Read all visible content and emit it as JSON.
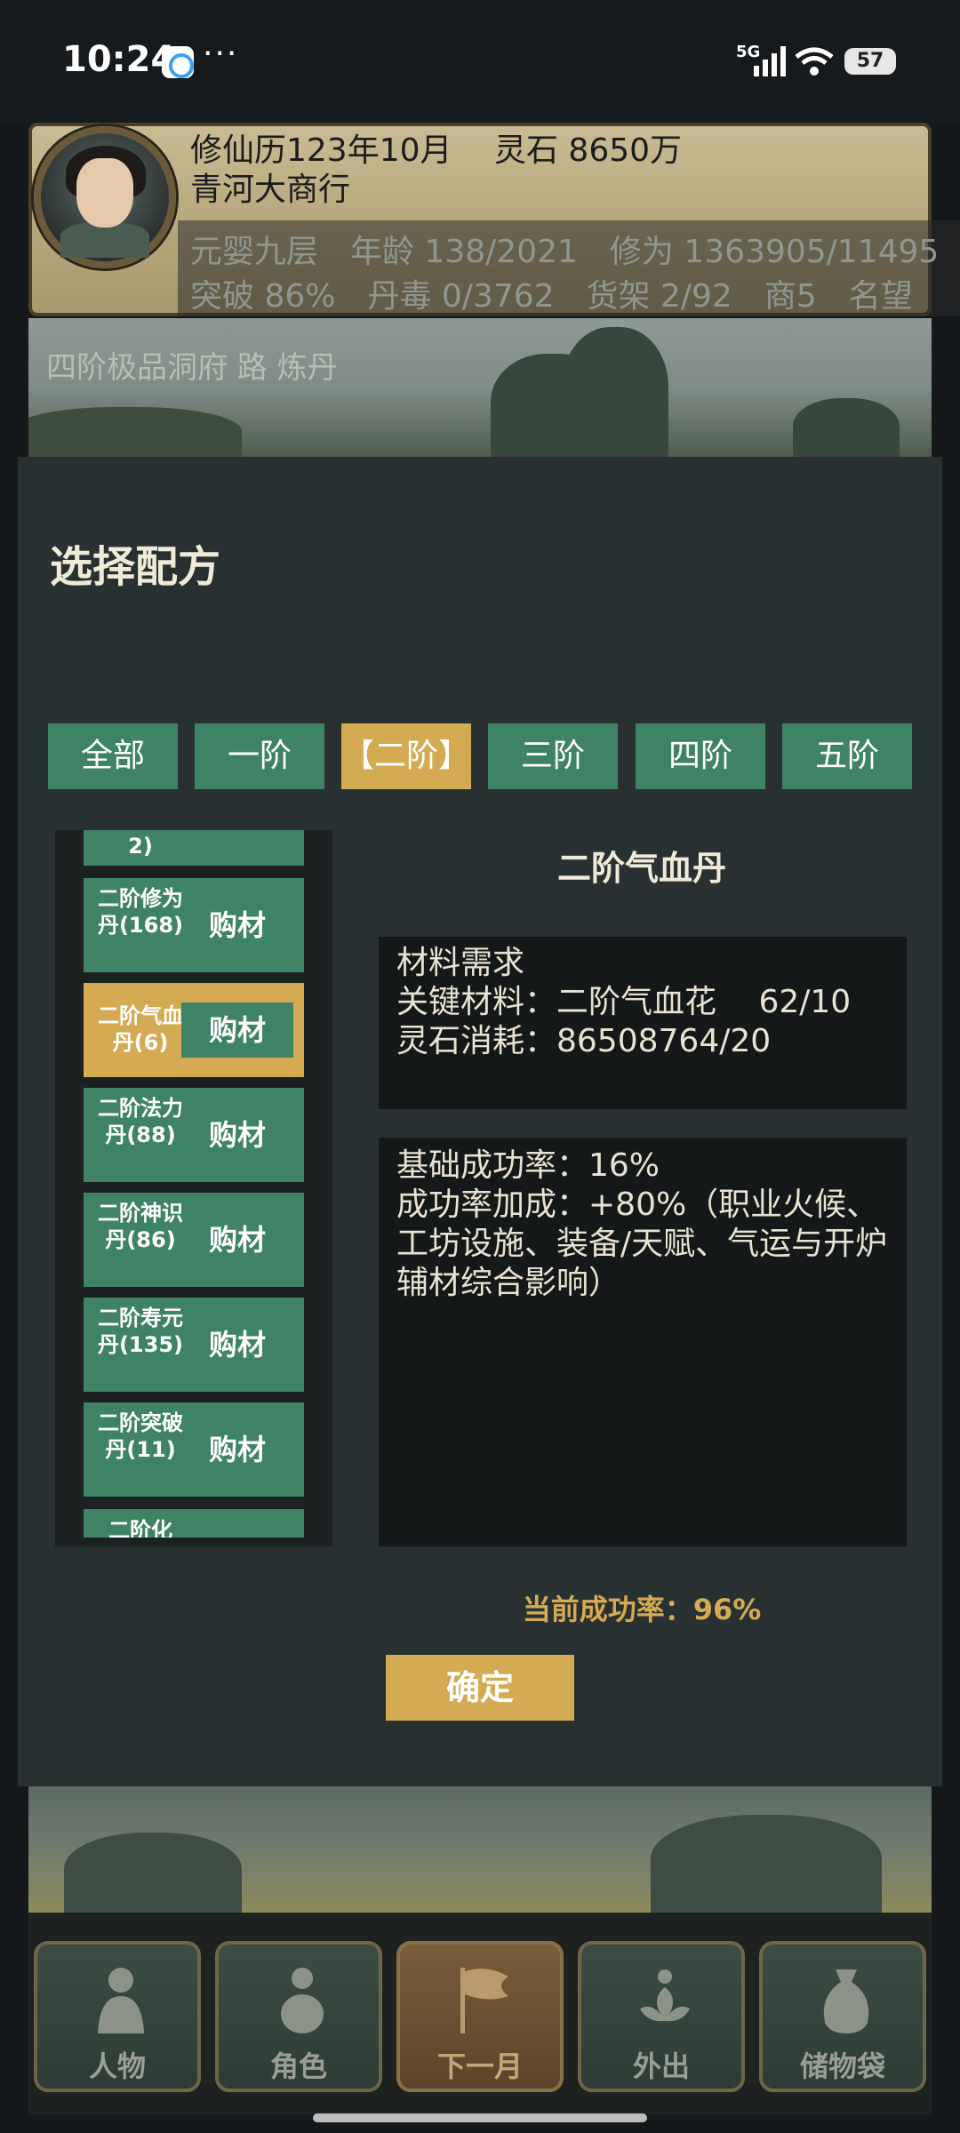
{
  "status_bar": {
    "time": "10:24",
    "more": "···",
    "network": "5G",
    "battery": "57",
    "app_icon": "chat-bubble-icon",
    "signal_icon": "signal-bars-icon",
    "wifi_icon": "wifi-icon"
  },
  "header": {
    "calendar": "修仙历123年10月",
    "spirit_stone": "灵石 8650万",
    "shop_name": "青河大商行",
    "stats_row1": "元婴九层　年龄 138/2021　修为 1363905/11495",
    "stats_row2": "突破 86%　丹毒 0/3762　货架 2/92　商5　名望",
    "avatar_icon": "character-portrait-icon"
  },
  "scene": {
    "location": "四阶极品洞府 路 炼丹"
  },
  "dialog": {
    "title": "选择配方",
    "tabs": [
      "全部",
      "一阶",
      "【二阶】",
      "三阶",
      "四阶",
      "五阶"
    ],
    "active_tab_color": "#d4aa52",
    "tab_color": "#3f8367",
    "recipe_top_partial": "2)",
    "recipes": [
      {
        "name": "二阶修为丹(168)",
        "buy": "购材"
      },
      {
        "name": "二阶气血丹(6)",
        "buy": "购材"
      },
      {
        "name": "二阶法力丹(88)",
        "buy": "购材"
      },
      {
        "name": "二阶神识丹(86)",
        "buy": "购材"
      },
      {
        "name": "二阶寿元丹(135)",
        "buy": "购材"
      },
      {
        "name": "二阶突破丹(11)",
        "buy": "购材"
      }
    ],
    "recipe_bottom_partial": "二阶化",
    "detail": {
      "title": "二阶气血丹",
      "materials_header": "材料需求",
      "key_material": "关键材料：二阶气血花　 62/10",
      "stone_cost": "灵石消耗：86508764/20",
      "base_rate": "基础成功率：16%",
      "bonus_rate": "成功率加成：+80%（职业火候、工坊设施、装备/天赋、气运与开炉辅材综合影响）"
    },
    "current_rate": "当前成功率：96%",
    "confirm": "确定"
  },
  "nav": [
    {
      "label": "人物",
      "icon": "person-icon"
    },
    {
      "label": "角色",
      "icon": "gourd-icon"
    },
    {
      "label": "下一月",
      "icon": "flag-icon"
    },
    {
      "label": "外出",
      "icon": "lotus-icon"
    },
    {
      "label": "储物袋",
      "icon": "bag-icon"
    }
  ]
}
